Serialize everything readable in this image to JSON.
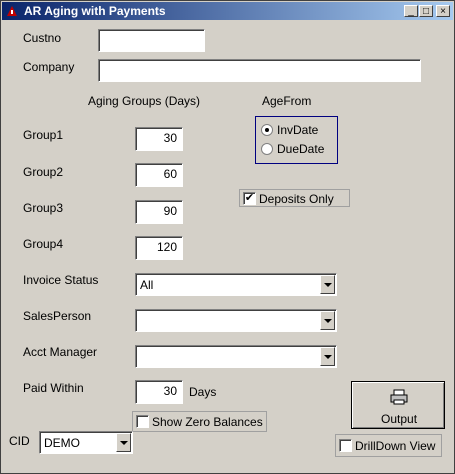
{
  "window": {
    "title": "AR Aging with Payments"
  },
  "fields": {
    "custno_label": "Custno",
    "custno_value": "",
    "company_label": "Company",
    "company_value": "",
    "aging_header": "Aging Groups (Days)",
    "agefrom_header": "AgeFrom",
    "groups": [
      {
        "label": "Group1",
        "value": "30"
      },
      {
        "label": "Group2",
        "value": "60"
      },
      {
        "label": "Group3",
        "value": "90"
      },
      {
        "label": "Group4",
        "value": "120"
      }
    ],
    "agefrom_options": [
      {
        "label": "InvDate",
        "selected": true
      },
      {
        "label": "DueDate",
        "selected": false
      }
    ],
    "deposits_only": {
      "label": "Deposits Only",
      "checked": true
    },
    "invoice_status": {
      "label": "Invoice Status",
      "value": "All"
    },
    "salesperson": {
      "label": "SalesPerson",
      "value": ""
    },
    "acct_manager": {
      "label": "Acct Manager",
      "value": ""
    },
    "paid_within": {
      "label": "Paid Within",
      "value": "30",
      "unit": "Days"
    },
    "show_zero": {
      "label": "Show Zero Balances",
      "checked": false
    },
    "cid": {
      "label": "CID",
      "value": "DEMO"
    },
    "output_button": "Output",
    "drilldown": {
      "label": "DrillDown View",
      "checked": false
    }
  },
  "icons": {
    "titlebar": "app-icon",
    "output": "printer-icon"
  },
  "colors": {
    "titlebar_start": "#0a246a",
    "titlebar_end": "#a6caf0",
    "face": "#d4d0c8"
  }
}
